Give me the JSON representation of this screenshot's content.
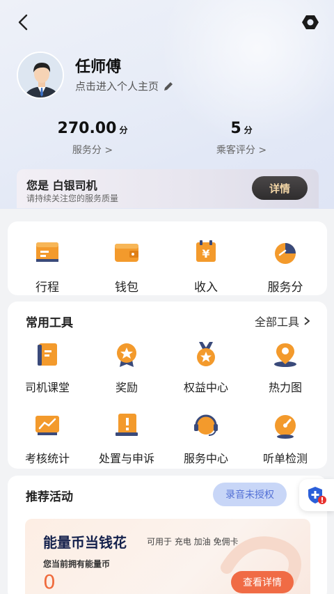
{
  "profile": {
    "name": "任师傅",
    "link_label": "点击进入个人主页"
  },
  "stats": [
    {
      "value": "270.00",
      "unit": "分",
      "label": "服务分 >"
    },
    {
      "value": "5",
      "unit": "分",
      "label": "乘客评分 >"
    }
  ],
  "level": {
    "title": "您是 白银司机",
    "subtitle": "请持续关注您的服务质量",
    "button": "详情"
  },
  "quick_actions": [
    {
      "label": "行程",
      "icon": "itinerary-icon"
    },
    {
      "label": "钱包",
      "icon": "wallet-icon"
    },
    {
      "label": "收入",
      "icon": "income-icon"
    },
    {
      "label": "服务分",
      "icon": "service-score-icon"
    }
  ],
  "tools": {
    "title": "常用工具",
    "all_label": "全部工具",
    "items": [
      {
        "label": "司机课堂",
        "icon": "book-icon"
      },
      {
        "label": "奖励",
        "icon": "reward-medal-icon"
      },
      {
        "label": "权益中心",
        "icon": "benefits-medal-icon"
      },
      {
        "label": "热力图",
        "icon": "heatmap-pin-icon"
      },
      {
        "label": "考核统计",
        "icon": "chart-board-icon"
      },
      {
        "label": "处置与申诉",
        "icon": "appeal-board-icon"
      },
      {
        "label": "服务中心",
        "icon": "headset-icon"
      },
      {
        "label": "听单检测",
        "icon": "gauge-icon"
      }
    ]
  },
  "promo": {
    "title": "推荐活动",
    "record_label": "录音未授权",
    "card_title": "能量币当钱花",
    "card_desc": "可用于 充电 加油 免佣卡",
    "balance_label": "您当前拥有能量币",
    "balance": "0",
    "button": "查看详情"
  },
  "colors": {
    "accent_orange": "#f39a2c",
    "dark_navy": "#3a4a7a",
    "promo_button": "#f06b45"
  }
}
